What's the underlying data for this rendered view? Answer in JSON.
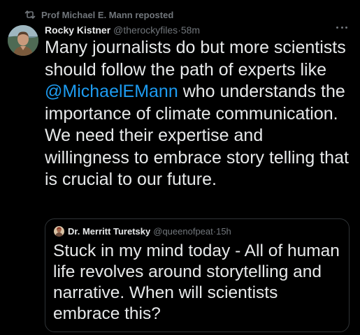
{
  "repost": {
    "label": "Prof Michael E. Mann reposted",
    "icon": "repost-icon"
  },
  "tweet": {
    "author_name": "Rocky Kistner",
    "author_handle": "@therockyfiles",
    "separator": "·",
    "time": "58m",
    "text_before_mention": "Many journalists do but more scientists should follow the path of experts like ",
    "mention": "@MichaelEMann",
    "text_after_mention": " who understands the importance of climate communication.  We need their expertise and willingness to embrace story telling that is crucial to our future."
  },
  "quoted_tweet": {
    "author_name": "Dr. Merritt Turetsky",
    "author_handle": "@queenofpeat",
    "separator": "·",
    "time": "15h",
    "text": "Stuck in my mind today - All of human life revolves around storytelling and narrative. When will scientists embrace this?"
  },
  "colors": {
    "background": "#000000",
    "text": "#e7e9ea",
    "secondary": "#71767b",
    "link": "#1d9bf0",
    "border": "#2f3336"
  },
  "icons": [
    "repost-icon",
    "more-icon",
    "avatar",
    "quote-avatar"
  ]
}
